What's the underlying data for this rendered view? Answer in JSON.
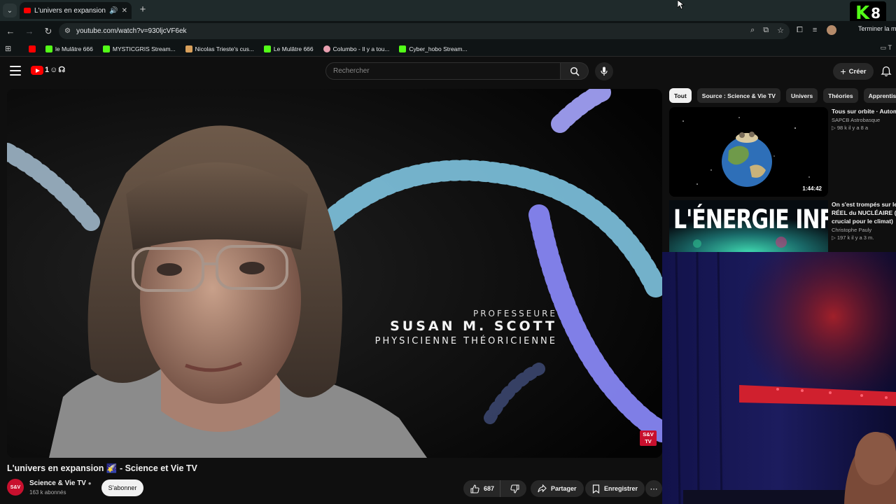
{
  "browser": {
    "tab_title": "L'univers en expansion 🌠",
    "url": "youtube.com/watch?v=930ljcVF6ek",
    "end_session_label": "Terminer la m",
    "bookmarks": [
      {
        "label": "le Mulâtre 666",
        "color": "#53fc18"
      },
      {
        "label": "MYSTICGRIS Stream...",
        "color": "#53fc18"
      },
      {
        "label": "Nicolas Trieste's cus...",
        "color": "#d9a05b"
      },
      {
        "label": "Le Mulâtre 666",
        "color": "#53fc18"
      },
      {
        "label": "Columbo - Il y a tou...",
        "color": "#e8a0b0"
      },
      {
        "label": "Cyber_hobo Stream...",
        "color": "#53fc18"
      }
    ]
  },
  "overlay": {
    "k_letter": "K",
    "k_number": "8"
  },
  "youtube": {
    "search_placeholder": "Rechercher",
    "create_label": "Créer"
  },
  "video": {
    "caption_role": "PROFESSEURE",
    "caption_name": "SUSAN M. SCOTT",
    "caption_title": "PHYSICIENNE THÉORICIENNE",
    "badge": "S&V TV",
    "title": "L'univers en expansion 🌠 - Science et Vie TV",
    "channel_name": "Science & Vie TV",
    "channel_initials": "S&V",
    "subscribers": "163 k abonnés",
    "subscribe_label": "S'abonner",
    "likes": "687",
    "share_label": "Partager",
    "save_label": "Enregistrer"
  },
  "chips": [
    "Tout",
    "Source : Science & Vie TV",
    "Univers",
    "Théories",
    "Apprentissag"
  ],
  "recommendations": [
    {
      "title_line1": "Tous sur orbite · Autom",
      "channel": "SAPCB Astrobasque",
      "meta": "▷ 98 k  il y a 8 a",
      "duration": "1:44:42"
    },
    {
      "title_line1": "On s'est trompés sur le",
      "title_line2": "RÉEL du NUCLÉAIRE (et",
      "title_line3": "crucial pour le climat)",
      "channel": "Christophe Pauly",
      "meta": "▷ 197 k  il y a 3 m.",
      "thumb_text": "L'ÉNERGIE INFINIE"
    }
  ]
}
